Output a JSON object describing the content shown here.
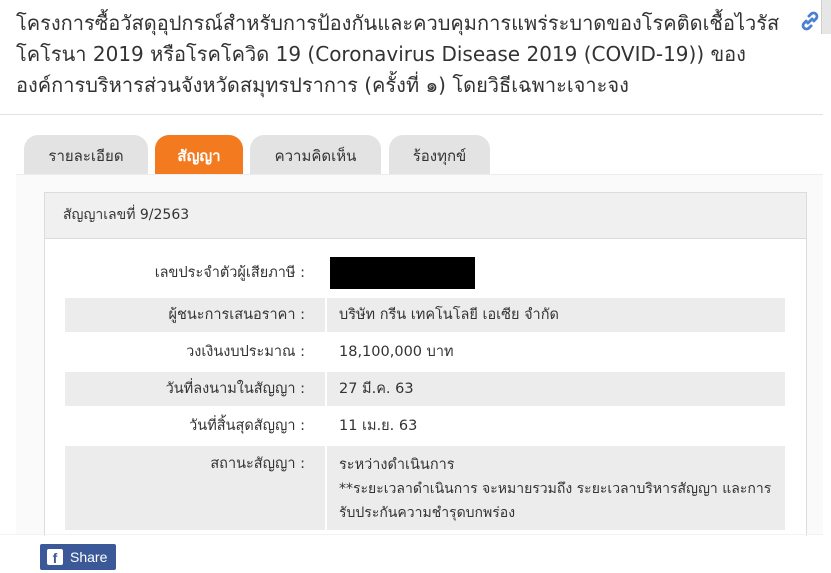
{
  "project": {
    "title": "โครงการซื้อวัสดุอุปกรณ์สำหรับการป้องกันและควบคุมการแพร่ระบาดของโรคติดเชื้อไวรัสโคโรนา 2019 หรือโรคโควิด 19 (Coronavirus Disease 2019 (COVID-19)) ของ องค์การบริหารส่วนจังหวัดสมุทรปราการ (ครั้งที่ ๑) โดยวิธีเฉพาะเจาะจง"
  },
  "tabs": [
    {
      "label": "รายละเอียด",
      "active": false
    },
    {
      "label": "สัญญา",
      "active": true
    },
    {
      "label": "ความคิดเห็น",
      "active": false
    },
    {
      "label": "ร้องทุกข์",
      "active": false
    }
  ],
  "contract": {
    "header": "สัญญาเลขที่ 9/2563",
    "rows": [
      {
        "label": "เลขประจำตัวผู้เสียภาษี :",
        "value": ""
      },
      {
        "label": "ผู้ชนะการเสนอราคา :",
        "value": "บริษัท กรีน เทคโนโลยี เอเซีย จำกัด"
      },
      {
        "label": "วงเงินงบประมาณ :",
        "value": "18,100,000 บาท"
      },
      {
        "label": "วันที่ลงนามในสัญญา :",
        "value": "27 มี.ค. 63"
      },
      {
        "label": "วันที่สิ้นสุดสัญญา :",
        "value": "11 เม.ย. 63"
      },
      {
        "label": "สถานะสัญญา :",
        "value": "ระหว่างดำเนินการ",
        "note": "**ระยะเวลาดำเนินการ จะหมายรวมถึง ระยะเวลาบริหารสัญญา และการรับประกันความชำรุดบกพร่อง"
      }
    ]
  },
  "share": {
    "label": "Share",
    "logo": "f"
  },
  "icons": {
    "link": "link-icon"
  },
  "colors": {
    "accent": "#f47a20",
    "facebook": "#3b5998",
    "link": "#4a7fd1"
  }
}
